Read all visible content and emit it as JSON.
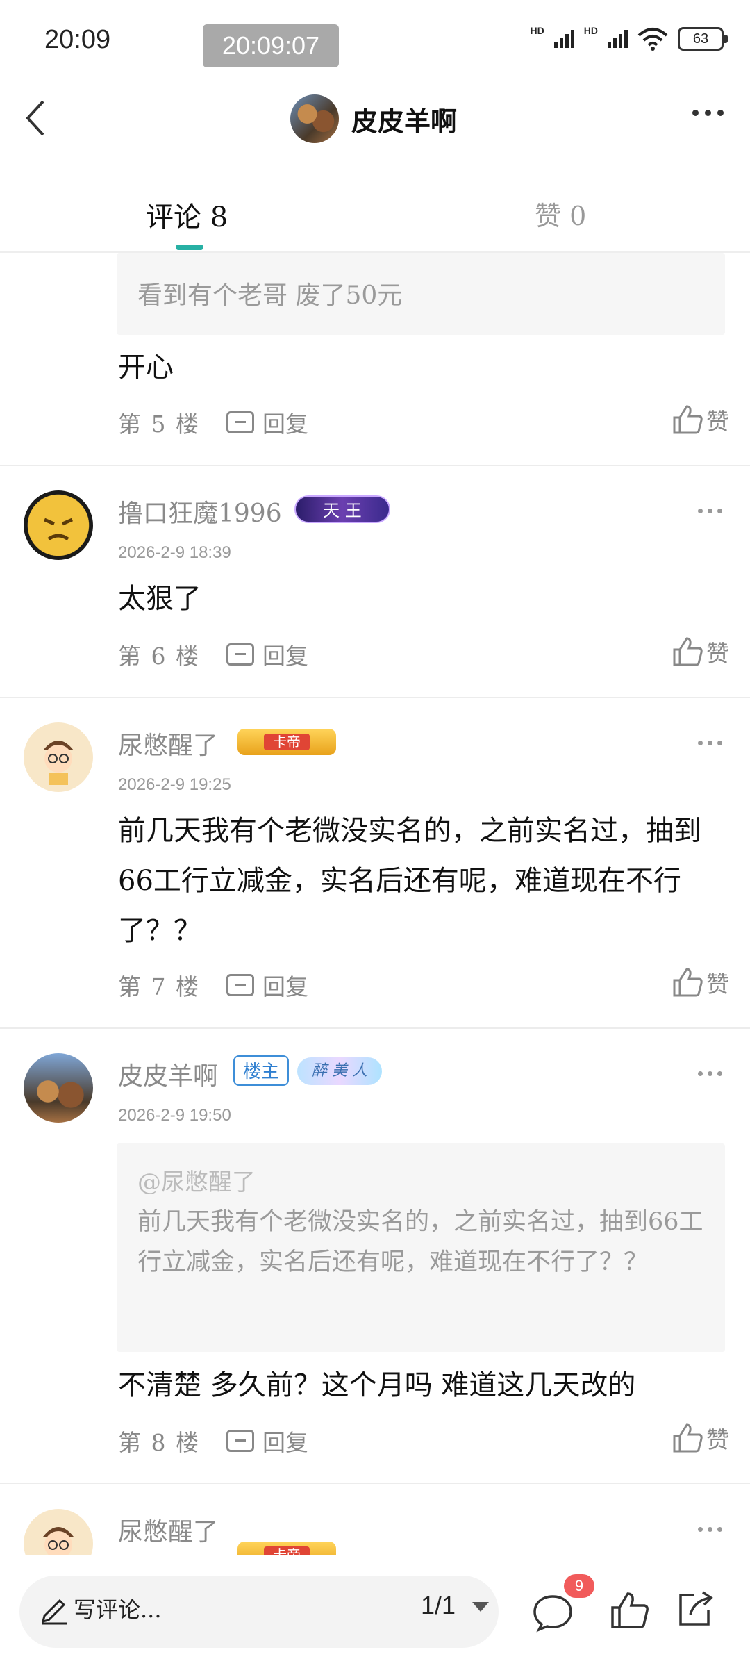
{
  "status_bar": {
    "time": "20:09",
    "toast_time": "20:09:07",
    "battery": "63",
    "network": "HD"
  },
  "header": {
    "title": "皮皮羊啊"
  },
  "tabs": {
    "comments": "评论 8",
    "likes": "赞 0"
  },
  "comments": [
    {
      "quote_text": "看到有个老哥 废了50元",
      "content": "开心",
      "floor": "第 5 楼",
      "reply": "回复",
      "like": "赞"
    },
    {
      "user": "撸口狂魔1996",
      "badge": "天 王",
      "time": "2026-2-9 18:39",
      "content": "太狠了",
      "floor": "第 6 楼",
      "reply": "回复",
      "like": "赞"
    },
    {
      "user": "尿憋醒了",
      "badge": "卡帝",
      "time": "2026-2-9 19:25",
      "content": "前几天我有个老微没实名的，之前实名过，抽到66工行立减金，实名后还有呢，难道现在不行了？？",
      "floor": "第 7 楼",
      "reply": "回复",
      "like": "赞"
    },
    {
      "user": "皮皮羊啊",
      "badge": "楼主",
      "badge2": "醉 美 人",
      "time": "2026-2-9 19:50",
      "quote_author": "@尿憋醒了",
      "quote_text": "前几天我有个老微没实名的，之前实名过，抽到66工行立减金，实名后还有呢，难道现在不行了？？",
      "content": "不清楚 多久前？这个月吗 难道这几天改的",
      "floor": "第 8 楼",
      "reply": "回复",
      "like": "赞"
    },
    {
      "user": "尿憋醒了",
      "badge": "卡帝"
    }
  ],
  "bottom_bar": {
    "write_placeholder": "写评论...",
    "page": "1/1",
    "comment_count": "9"
  },
  "colors": {
    "accent": "#27b0a4",
    "notification": "#f15b5b",
    "owner_badge": "#2f7fd0"
  }
}
